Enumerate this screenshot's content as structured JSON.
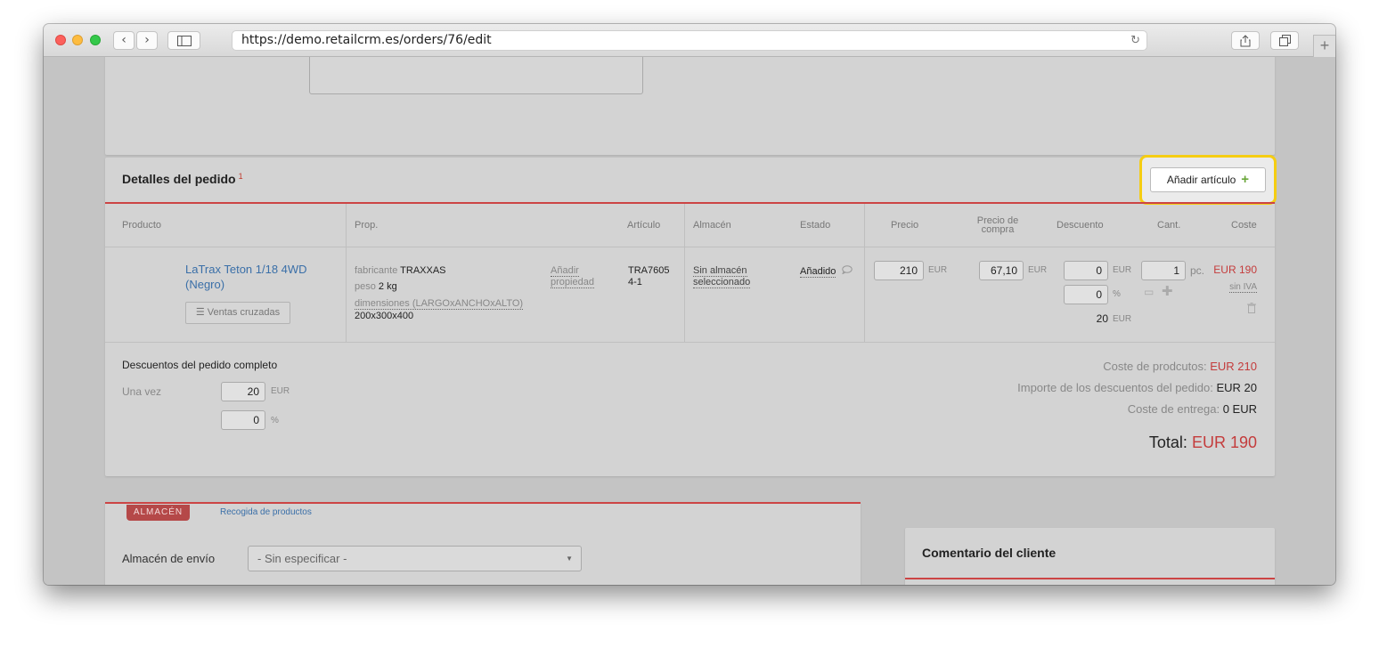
{
  "browser": {
    "url": "https://demo.retailcrm.es/orders/76/edit",
    "back_glyph": "‹",
    "forward_glyph": "›",
    "reload_glyph": "↻",
    "new_tab_glyph": "+"
  },
  "order": {
    "title": "Detalles del pedido",
    "title_badge": "1",
    "add_item_label": "Añadir artículo",
    "add_item_icon": "plus-icon",
    "columns": [
      "Producto",
      "Prop.",
      "Artículo",
      "Almacén",
      "Estado",
      "Precio",
      "Precio de compra",
      "Descuento",
      "Cant.",
      "Coste"
    ],
    "item": {
      "name": "LaTrax Teton 1/18 4WD (Negro)",
      "cross_sell_label": "Ventas cruzadas",
      "props": [
        {
          "key": "fabricante",
          "value": "TRAXXAS"
        },
        {
          "key": "peso",
          "value": "2 kg"
        },
        {
          "key": "dimensiones (LARGOxANCHOxALTO)",
          "value": "200x300x400"
        }
      ],
      "add_property": "Añadir propiedad",
      "sku": "TRA76054-1",
      "warehouse": "Sin almacén seleccionado",
      "status": "Añadido",
      "price": "210",
      "price_unit": "EUR",
      "purchase_price": "67,10",
      "purchase_unit": "EUR",
      "discount_amount": "0",
      "discount_amount_unit": "EUR",
      "discount_percent": "0",
      "discount_percent_unit": "%",
      "discount_total": "20",
      "discount_total_unit": "EUR",
      "quantity": "1",
      "quantity_unit": "pc.",
      "cost": "EUR 190",
      "vat": "sin IVA"
    },
    "order_discounts": {
      "title": "Descuentos del pedido completo",
      "once_label": "Una vez",
      "amount": "20",
      "amount_unit": "EUR",
      "percent": "0",
      "percent_unit": "%"
    },
    "summary": {
      "products_cost_label": "Coste de prodcutos:",
      "products_cost": "EUR 210",
      "discount_label": "Importe de los descuentos del pedido:",
      "discount": "EUR 20",
      "delivery_label": "Coste de entrega:",
      "delivery": "0 EUR",
      "total_label": "Total:",
      "total": "EUR 190"
    }
  },
  "warehouse_section": {
    "tab_active": "ALMACÉN",
    "tab_link": "Recogida de productos",
    "shipping_label": "Almacén de envío",
    "shipping_value": "- Sin especificar -"
  },
  "customer_comment": {
    "title": "Comentario del cliente"
  },
  "colors": {
    "accent_red": "#c43c3c",
    "highlight": "#f5cd12",
    "plus_green": "#6aa73a",
    "link_blue": "#3a6fa8"
  }
}
